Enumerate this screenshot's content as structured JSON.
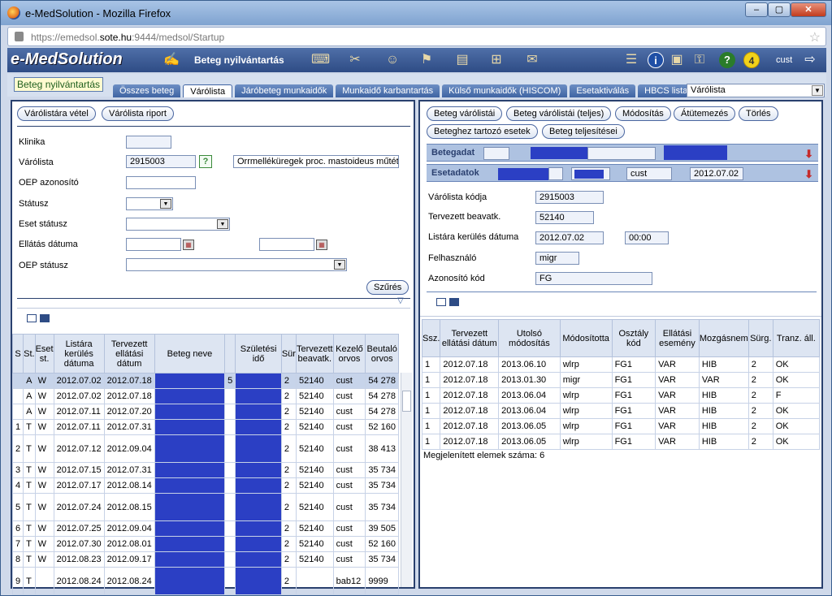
{
  "window": {
    "title": "e-MedSolution - Mozilla Firefox"
  },
  "url": {
    "pre": "https://emedsol.",
    "domain": "sote.hu",
    "post": ":9444/medsol/Startup"
  },
  "app": {
    "logo": "e-MedSolution",
    "module": "Beteg nyilvántartás",
    "user": "cust",
    "badge_count": "4"
  },
  "module_label": "Beteg nyilvántartás",
  "tabs": [
    "Összes beteg",
    "Várólista",
    "Járóbeteg munkaidők",
    "Munkaidő karbantartás",
    "Külső munkaidők (HISCOM)",
    "Esetaktiválás",
    "HBCS lista"
  ],
  "active_tab": "Várólista",
  "tab_select": "Várólista",
  "left": {
    "buttons": [
      "Várólistára vétel",
      "Várólista riport"
    ],
    "filters": {
      "klinika": "Klinika",
      "varolista": "Várólista",
      "varolista_value": "2915003",
      "varolista_desc": "Orrmelléküregek proc. mastoideus műtéte",
      "oep_azon": "OEP azonosító",
      "statusz": "Státusz",
      "eset_statusz": "Eset státusz",
      "ellatas_datuma": "Ellátás dátuma",
      "oep_statusz": "OEP státusz"
    },
    "szures": "Szűrés",
    "table": {
      "headers": [
        "S",
        "St.",
        "Eset st.",
        "Listára kerülés dátuma",
        "Tervezett ellátási dátum",
        "Beteg neve",
        "",
        "Születési idő",
        "Sür",
        "Tervezett beavatk.",
        "Kezelő orvos",
        "Beutaló orvos"
      ],
      "rows": [
        [
          "",
          "A",
          "W",
          "2012.07.02",
          "2012.07.18",
          "",
          "5",
          "",
          "2",
          "52140",
          "cust",
          "54 278"
        ],
        [
          "",
          "A",
          "W",
          "2012.07.02",
          "2012.07.18",
          "",
          "",
          "",
          "2",
          "52140",
          "cust",
          "54 278"
        ],
        [
          "",
          "A",
          "W",
          "2012.07.11",
          "2012.07.20",
          "",
          "",
          "",
          "2",
          "52140",
          "cust",
          "54 278"
        ],
        [
          "1",
          "T",
          "W",
          "2012.07.11",
          "2012.07.31",
          "",
          "",
          "",
          "2",
          "52140",
          "cust",
          "52 160"
        ],
        [
          "2",
          "T",
          "W",
          "2012.07.12",
          "2012.09.04",
          "",
          "",
          "",
          "2",
          "52140",
          "cust",
          "38 413"
        ],
        [
          "3",
          "T",
          "W",
          "2012.07.15",
          "2012.07.31",
          "",
          "",
          "",
          "2",
          "52140",
          "cust",
          "35 734"
        ],
        [
          "4",
          "T",
          "W",
          "2012.07.17",
          "2012.08.14",
          "",
          "",
          "",
          "2",
          "52140",
          "cust",
          "35 734"
        ],
        [
          "5",
          "T",
          "W",
          "2012.07.24",
          "2012.08.15",
          "",
          "",
          "",
          "2",
          "52140",
          "cust",
          "35 734"
        ],
        [
          "6",
          "T",
          "W",
          "2012.07.25",
          "2012.09.04",
          "",
          "",
          "",
          "2",
          "52140",
          "cust",
          "39 505"
        ],
        [
          "7",
          "T",
          "W",
          "2012.07.30",
          "2012.08.01",
          "",
          "",
          "",
          "2",
          "52140",
          "cust",
          "52 160"
        ],
        [
          "8",
          "T",
          "W",
          "2012.08.23",
          "2012.09.17",
          "",
          "",
          "",
          "2",
          "52140",
          "cust",
          "35 734"
        ],
        [
          "9",
          "T",
          "",
          "2012.08.24",
          "2012.08.24",
          "",
          "",
          "",
          "2",
          "",
          "bab12",
          "9999"
        ]
      ]
    }
  },
  "right": {
    "buttons_row1": [
      "Beteg várólistái",
      "Beteg várólistái (teljes)",
      "Módosítás",
      "Átütemezés",
      "Törlés"
    ],
    "buttons_row2": [
      "Beteghez tartozó esetek",
      "Beteg teljesítései"
    ],
    "betegadat": "Betegadat",
    "esetadatok": "Esetadatok",
    "eset_user": "cust",
    "eset_date": "2012.07.02",
    "fields": {
      "varolista_kodja": {
        "label": "Várólista kódja",
        "value": "2915003"
      },
      "tervezett_beavatk": {
        "label": "Tervezett beavatk.",
        "value": "52140"
      },
      "listara_kerules": {
        "label": "Listára kerülés dátuma",
        "value": "2012.07.02",
        "time": "00:00"
      },
      "felhasznalo": {
        "label": "Felhasználó",
        "value": "migr"
      },
      "azonosito_kod": {
        "label": "Azonosító kód",
        "value": "FG"
      }
    },
    "table": {
      "headers": [
        "Ssz.",
        "Tervezett ellátási dátum",
        "Utolsó módosítás",
        "Módosította",
        "Osztály kód",
        "Ellátási esemény",
        "Mozgásnem",
        "Sürg.",
        "Tranz. áll."
      ],
      "rows": [
        [
          "1",
          "2012.07.18",
          "2013.06.10",
          "wlrp",
          "FG1",
          "VAR",
          "HIB",
          "2",
          "OK"
        ],
        [
          "1",
          "2012.07.18",
          "2013.01.30",
          "migr",
          "FG1",
          "VAR",
          "VAR",
          "2",
          "OK"
        ],
        [
          "1",
          "2012.07.18",
          "2013.06.04",
          "wlrp",
          "FG1",
          "VAR",
          "HIB",
          "2",
          "F"
        ],
        [
          "1",
          "2012.07.18",
          "2013.06.04",
          "wlrp",
          "FG1",
          "VAR",
          "HIB",
          "2",
          "OK"
        ],
        [
          "1",
          "2012.07.18",
          "2013.06.05",
          "wlrp",
          "FG1",
          "VAR",
          "HIB",
          "2",
          "OK"
        ],
        [
          "1",
          "2012.07.18",
          "2013.06.05",
          "wlrp",
          "FG1",
          "VAR",
          "HIB",
          "2",
          "OK"
        ]
      ]
    },
    "footer": "Megjelenített elemek száma: 6"
  },
  "icons": [
    "firefox-icon",
    "lock-icon",
    "bookmark-star-icon",
    "patient-register-icon",
    "keyboard-icon",
    "tools-icon",
    "doctor-icon",
    "exit-door-icon",
    "pdf-icon",
    "org-chart-icon",
    "mail-icon",
    "report-icon",
    "info-icon",
    "computer-icon",
    "key-icon",
    "help-icon",
    "logout-icon",
    "calendar-icon",
    "grid-view-icon",
    "sort-arrow-icon",
    "delete-arrow-icon"
  ]
}
